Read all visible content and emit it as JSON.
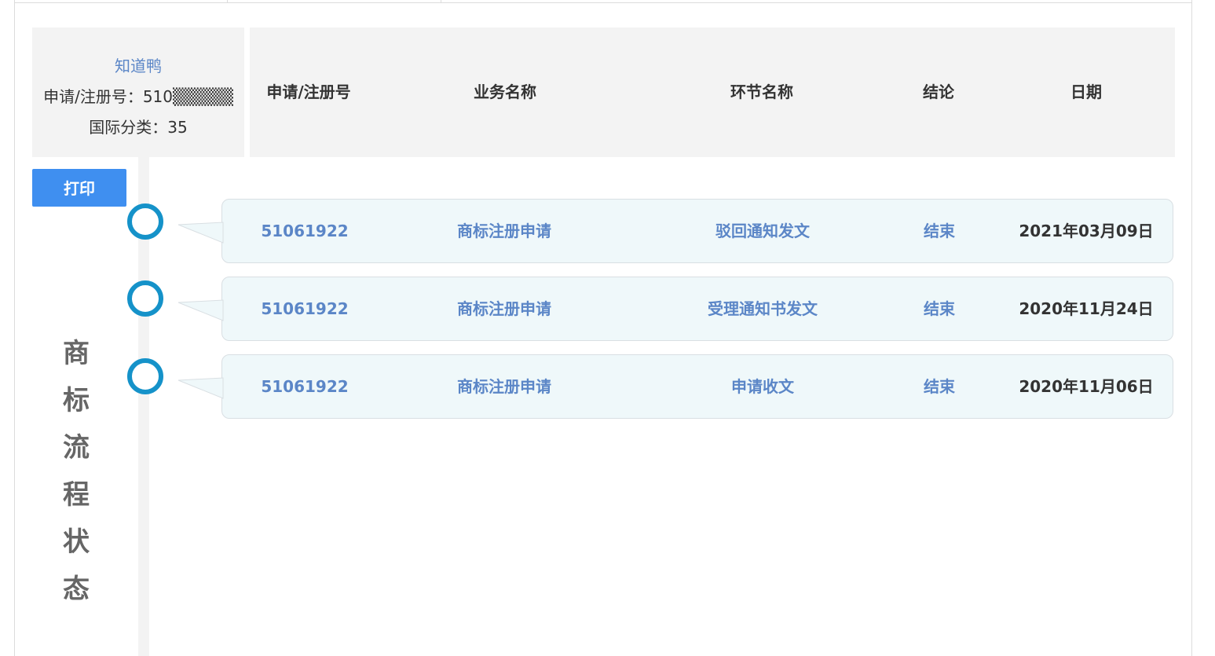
{
  "info": {
    "company": "知道鸭",
    "reg_number": "申请/注册号：510▒▒▒▒▒",
    "intl_class": "国际分类：35"
  },
  "table": {
    "headers": [
      "申请/注册号",
      "业务名称",
      "环节名称",
      "结论",
      "日期"
    ],
    "rows": [
      {
        "reg_no": "51061922",
        "business": "商标注册申请",
        "stage": "驳回通知发文",
        "result": "结束",
        "date": "2021年03月09日"
      },
      {
        "reg_no": "51061922",
        "business": "商标注册申请",
        "stage": "受理通知书发文",
        "result": "结束",
        "date": "2020年11月24日"
      },
      {
        "reg_no": "51061922",
        "business": "商标注册申请",
        "stage": "申请收文",
        "result": "结束",
        "date": "2020年11月06日"
      }
    ]
  },
  "print_label": "打印",
  "side_title": [
    "商",
    "标",
    "流",
    "程",
    "状",
    "态"
  ],
  "colors": {
    "accent_blue": "#3f8ff0",
    "link_blue": "#5b86c7",
    "timeline_ring": "#1592c9",
    "row_bg": "#eff8fa",
    "panel_bg": "#f3f3f3"
  }
}
